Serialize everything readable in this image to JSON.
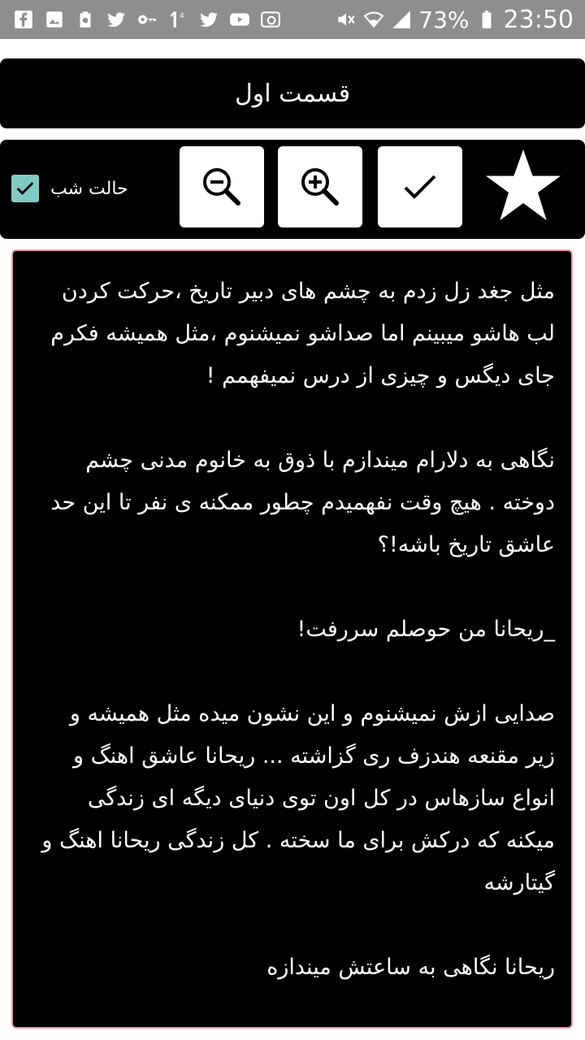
{
  "status_bar": {
    "battery_percent": "73%",
    "time": "23:50",
    "notification_icons": [
      "facebook-icon",
      "gallery-icon",
      "recycle-icon",
      "twitter-icon",
      "key-icon",
      "download-icon",
      "twitter-icon",
      "youtube-icon",
      "message-icon"
    ],
    "system_icons": [
      "mute-icon",
      "wifi-icon",
      "signal-icon",
      "battery-icon"
    ]
  },
  "title": "قسمت اول",
  "toolbar": {
    "night_mode_label": "حالت شب",
    "night_mode_checked": true,
    "buttons": [
      "zoom-out-icon",
      "zoom-in-icon",
      "check-icon",
      "star-icon"
    ]
  },
  "story": {
    "paragraphs": [
      "مثل جغد زل زدم به چشم های دبیر تاریخ ،حرکت کردن لب هاشو میبینم اما صداشو نمیشنوم ،مثل همیشه فکرم جای دیگس و چیزی از درس نمیفهمم !",
      "",
      "نگاهی به دلارام میندازم با ذوق به خانوم مدنی چشم دوخته . هیچ وقت نفهمیدم چطور ممکنه ی نفر تا این حد عاشق تاریخ باشه!؟",
      "",
      "_ریحانا من حوصلم سررفت!",
      "",
      "صدایی ازش نمیشنوم و این نشون میده  مثل همیشه و زیر مقنعه هندزف ری گزاشته ... ریحانا عاشق اهنگ و انواع سازهاس در کل اون توی دنیای دیگه ای زندگی میکنه که درکش برای ما سخته . کل زندگی ریحانا اهنگ و گیتارشه",
      "",
      "ریحانا نگاهی به ساعتش میندازه"
    ]
  },
  "colors": {
    "status_bar_bg": "#8e8e8e",
    "panel_bg": "#000000",
    "checkbox": "#80cbc4",
    "story_border": "#e79ba7"
  }
}
